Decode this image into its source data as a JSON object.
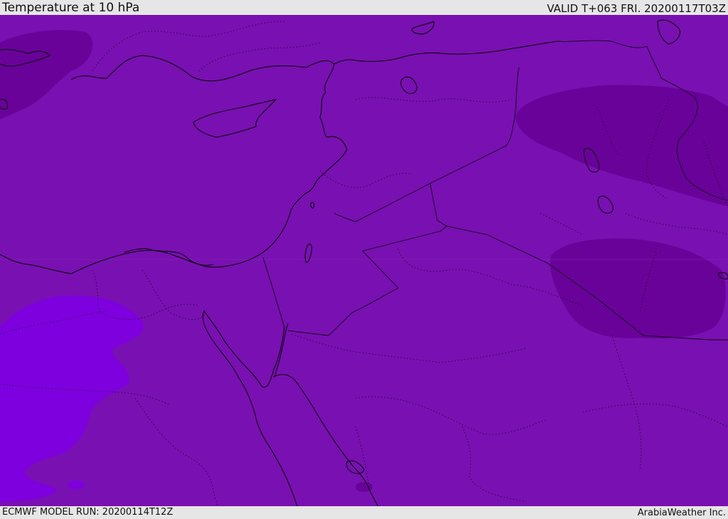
{
  "header": {
    "title": "Temperature at 10 hPa",
    "valid_time": "VALID T+063 FRI. 20200117T03Z"
  },
  "footer": {
    "model_run": "ECMWF MODEL RUN: 20200114T12Z",
    "credit": "ArabiaWeather Inc."
  },
  "colors": {
    "base_field": "#7910b1",
    "warmer_field": "#7e00de",
    "colder_field": "#690299",
    "coastline": "#000000",
    "borders": "#1a0030"
  }
}
